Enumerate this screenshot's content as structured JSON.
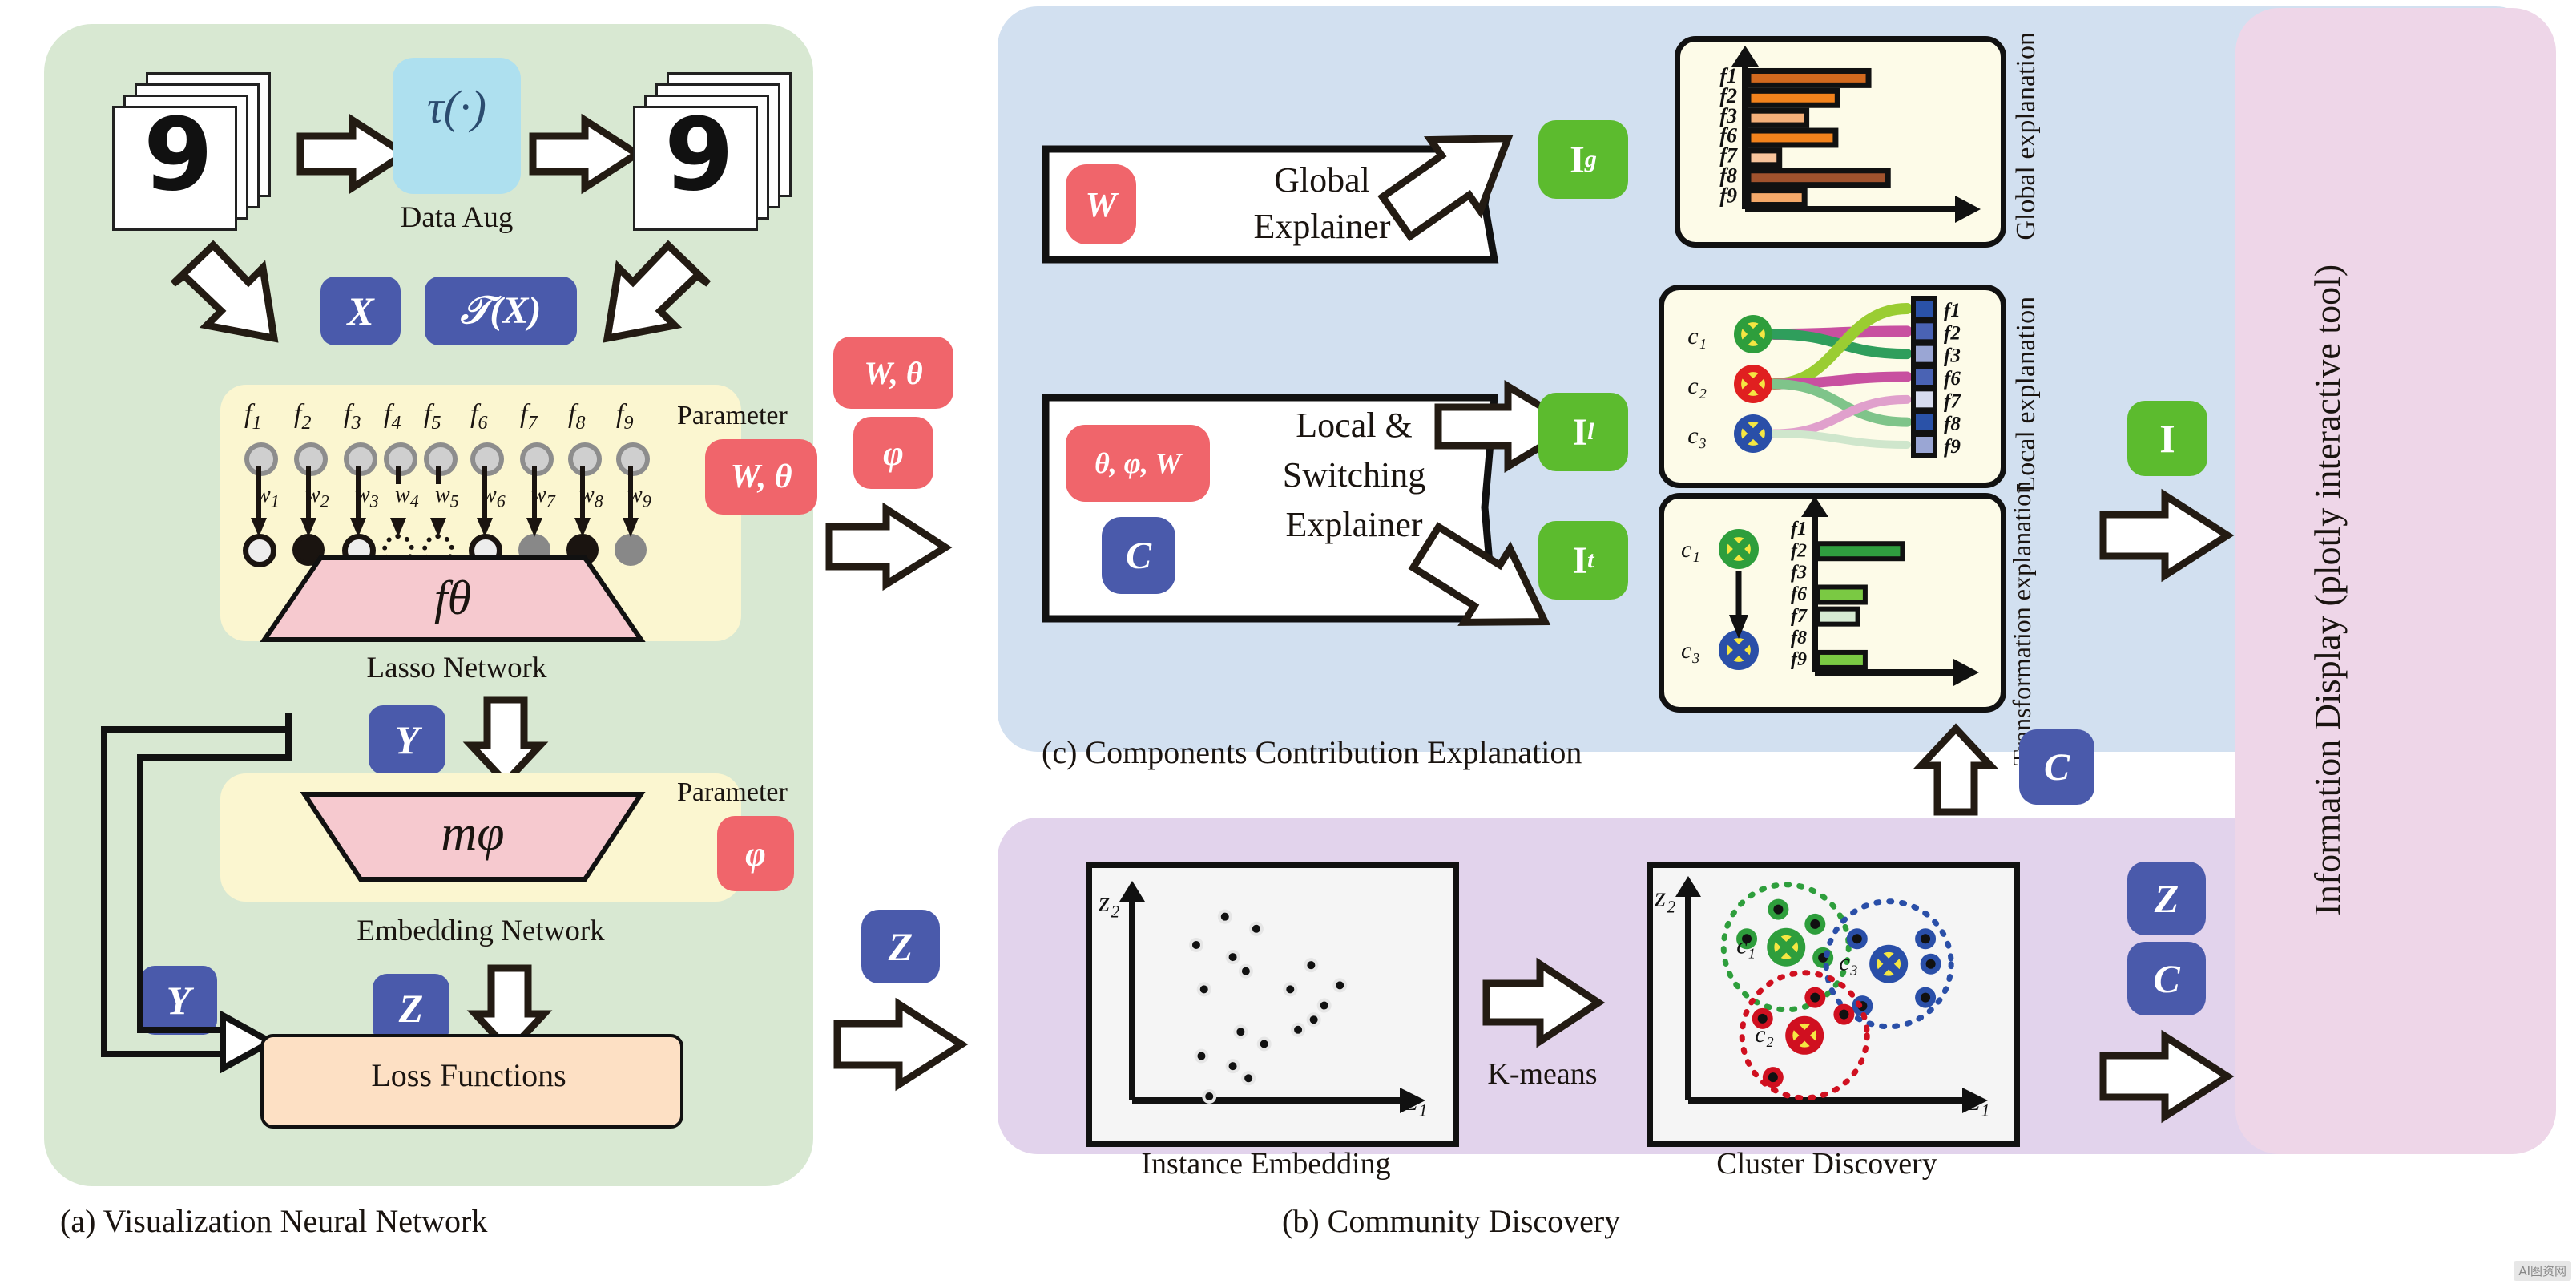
{
  "panels": {
    "a": {
      "caption": "(a) Visualization Neural Network",
      "data_aug_label": "Data Aug",
      "tau": "τ(·)",
      "x_chip": "X",
      "tx_chip": "𝒯(X)",
      "lasso_label": "Lasso Network",
      "f_theta": "fθ",
      "m_phi": "mφ",
      "embedding_label": "Embedding Network",
      "loss_label": "Loss Functions",
      "param_label_1": "Parameter",
      "param_label_2": "Parameter",
      "param_value_1": "W, θ",
      "param_value_2": "φ",
      "y_chip": "Y",
      "y_chip2": "Y",
      "z_chip": "Z",
      "z_chip2": "Z",
      "features": [
        "f1",
        "f2",
        "f3",
        "f4",
        "f5",
        "f6",
        "f7",
        "f8",
        "f9"
      ],
      "weights": [
        "w1",
        "w2",
        "w3",
        "w4",
        "w5",
        "w6",
        "w7",
        "w8",
        "w9"
      ],
      "node_states": [
        "ring",
        "solid-black",
        "ring",
        "dotted",
        "dotted",
        "ring",
        "gray",
        "solid-black",
        "gray"
      ]
    },
    "c": {
      "caption": "(c) Components Contribution Explanation",
      "global_explainer": "Global\nExplainer",
      "global_explainer_lines": [
        "Global",
        "Explainer"
      ],
      "local_explainer_lines": [
        "Local &",
        "Switching",
        "Explainer"
      ],
      "global_chip": "W",
      "local_chip_top": "θ, φ, W",
      "local_chip_bottom": "C",
      "out_global": "I",
      "out_global_sup": "g",
      "out_local": "I",
      "out_local_sup": "l",
      "out_trans": "I",
      "out_trans_sup": "t",
      "side_global": "Global\nexplanation",
      "side_global_lines": [
        "Global",
        "explanation"
      ],
      "side_local_lines": [
        "Local",
        "explanation"
      ],
      "side_trans_lines": [
        "Transformation",
        "explanation"
      ],
      "c_chip": "C"
    },
    "b": {
      "caption": "(b) Community Discovery",
      "left_label": "Instance Embedding",
      "right_label": "Cluster Discovery",
      "kmeans": "K-means",
      "axis_x": "z₁",
      "axis_y": "z₂",
      "clusters": [
        "c₁",
        "c₂",
        "c₃"
      ]
    },
    "d": {
      "title_lines": [
        "Information Display",
        "(plotly interactive tool)"
      ],
      "in_chip_I": "I",
      "in_chip_Z": "Z",
      "in_chip_C": "C"
    }
  },
  "chart_data": [
    {
      "type": "bar",
      "name": "global-explanation",
      "orientation": "horizontal",
      "categories": [
        "f1",
        "f2",
        "f3",
        "f6",
        "f7",
        "f8",
        "f9"
      ],
      "values": [
        62,
        46,
        30,
        45,
        16,
        72,
        29
      ],
      "colors": [
        "#d2691e",
        "#f2821c",
        "#f5b07a",
        "#f2821c",
        "#f8c49c",
        "#a0522d",
        "#f5a96a"
      ],
      "title": "",
      "xlabel": "",
      "ylabel": "",
      "xlim": [
        0,
        100
      ],
      "grid": false,
      "legend": false
    },
    {
      "type": "bar",
      "name": "transformation-explanation",
      "orientation": "horizontal",
      "categories": [
        "f1",
        "f2",
        "f3",
        "f6",
        "f7",
        "f8",
        "f9"
      ],
      "values": [
        0,
        68,
        0,
        38,
        32,
        0,
        38
      ],
      "colors": [
        "#2f9e3f",
        "#2f9e3f",
        "#7ac943",
        "#7ac943",
        "#d6ead3",
        "#7ac943",
        "#7ac943"
      ],
      "title": "",
      "xlabel": "",
      "ylabel": "",
      "xlim": [
        0,
        100
      ],
      "grid": false,
      "legend": false
    },
    {
      "type": "sankey",
      "name": "local-explanation",
      "sources": [
        "c1",
        "c2",
        "c3"
      ],
      "source_colors": [
        "#2e9e3c",
        "#e02020",
        "#2a4fa8"
      ],
      "targets": [
        "f1",
        "f2",
        "f3",
        "f6",
        "f7",
        "f8",
        "f9"
      ],
      "target_colors": [
        "#2a52a8",
        "#4a63b4",
        "#9aa6d4",
        "#4a63b4",
        "#d7dcef",
        "#2a52a8",
        "#9aa6d4"
      ],
      "links": [
        {
          "source": "c1",
          "target": "f2",
          "color": "#c850a0",
          "width": 14
        },
        {
          "source": "c1",
          "target": "f3",
          "color": "#2f9e5c",
          "width": 13
        },
        {
          "source": "c2",
          "target": "f1",
          "color": "#9acd32",
          "width": 14
        },
        {
          "source": "c2",
          "target": "f6",
          "color": "#c850a0",
          "width": 13
        },
        {
          "source": "c2",
          "target": "f8",
          "color": "#7fc48a",
          "width": 12
        },
        {
          "source": "c3",
          "target": "f7",
          "color": "#e0a0cc",
          "width": 11
        },
        {
          "source": "c3",
          "target": "f9",
          "color": "#cfe6cc",
          "width": 10
        }
      ]
    },
    {
      "type": "scatter",
      "name": "instance-embedding",
      "xlabel": "z₁",
      "ylabel": "z₂",
      "points": [
        [
          0.3,
          0.86
        ],
        [
          0.42,
          0.8
        ],
        [
          0.19,
          0.72
        ],
        [
          0.33,
          0.66
        ],
        [
          0.38,
          0.59
        ],
        [
          0.63,
          0.62
        ],
        [
          0.74,
          0.52
        ],
        [
          0.22,
          0.5
        ],
        [
          0.55,
          0.5
        ],
        [
          0.68,
          0.42
        ],
        [
          0.64,
          0.35
        ],
        [
          0.36,
          0.29
        ],
        [
          0.58,
          0.3
        ],
        [
          0.45,
          0.23
        ],
        [
          0.21,
          0.17
        ],
        [
          0.33,
          0.12
        ],
        [
          0.39,
          0.06
        ],
        [
          0.24,
          -0.03
        ]
      ]
    },
    {
      "type": "scatter",
      "name": "cluster-discovery",
      "xlabel": "z₁",
      "ylabel": "z₂",
      "clusters": [
        {
          "label": "c₁",
          "color": "#2e9e3c",
          "center": [
            0.33,
            0.68
          ],
          "members": [
            [
              0.3,
              0.86
            ],
            [
              0.44,
              0.79
            ],
            [
              0.18,
              0.72
            ],
            [
              0.47,
              0.63
            ]
          ]
        },
        {
          "label": "c₃",
          "color": "#2a4fa8",
          "center": [
            0.72,
            0.6
          ],
          "members": [
            [
              0.6,
              0.72
            ],
            [
              0.86,
              0.72
            ],
            [
              0.88,
              0.6
            ],
            [
              0.86,
              0.44
            ],
            [
              0.62,
              0.4
            ]
          ]
        },
        {
          "label": "c₂",
          "color": "#d01020",
          "center": [
            0.4,
            0.26
          ],
          "members": [
            [
              0.44,
              0.44
            ],
            [
              0.55,
              0.36
            ],
            [
              0.24,
              0.34
            ],
            [
              0.28,
              0.06
            ]
          ]
        }
      ]
    }
  ],
  "watermark": "AI图资网"
}
